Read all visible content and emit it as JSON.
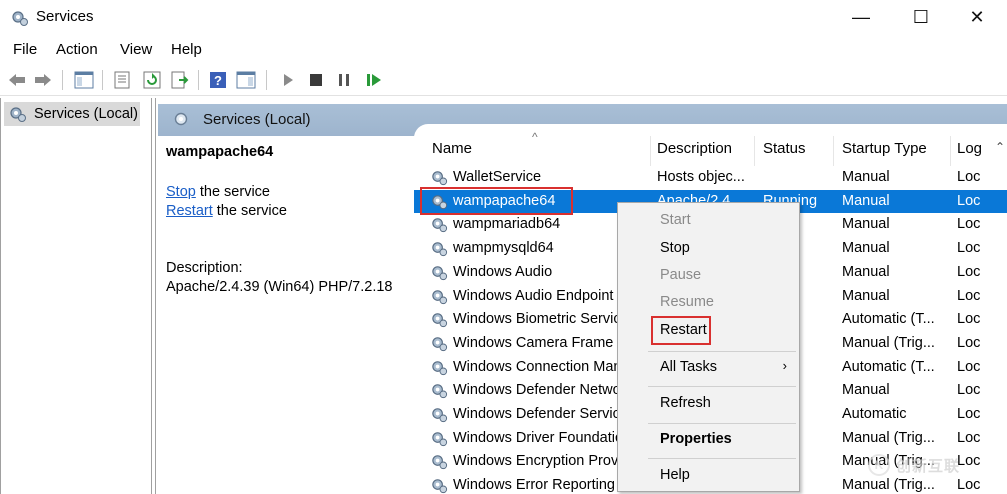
{
  "window": {
    "title": "Services",
    "minimize": "—",
    "maximize": "☐",
    "close": "✕"
  },
  "menu": [
    "File",
    "Action",
    "View",
    "Help"
  ],
  "tree": {
    "item": "Services (Local)"
  },
  "pane": {
    "header": "Services (Local)"
  },
  "left_info": {
    "service_name": "wampapache64",
    "stop_link": "Stop",
    "stop_rest": " the service",
    "restart_link": "Restart",
    "restart_rest": " the service",
    "desc_label": "Description:",
    "desc_text": "Apache/2.4.39 (Win64) PHP/7.2.18"
  },
  "columns": {
    "name": "Name",
    "description": "Description",
    "status": "Status",
    "startup": "Startup Type",
    "logon": "Log"
  },
  "rows": [
    {
      "name": "WalletService",
      "description": "Hosts objec...",
      "status": "",
      "startup": "Manual",
      "logon": "Loc"
    },
    {
      "name": "wampapache64",
      "description": "Apache/2.4...",
      "status": "Running",
      "startup": "Manual",
      "logon": "Loc"
    },
    {
      "name": "wampmariadb64",
      "description": "",
      "status": "ng",
      "startup": "Manual",
      "logon": "Loc"
    },
    {
      "name": "wampmysqld64",
      "description": "",
      "status": "ng",
      "startup": "Manual",
      "logon": "Loc"
    },
    {
      "name": "Windows Audio",
      "description": "",
      "status": "ng",
      "startup": "Manual",
      "logon": "Loc"
    },
    {
      "name": "Windows Audio Endpoint Builder",
      "description": "",
      "status": "",
      "startup": "Manual",
      "logon": "Loc"
    },
    {
      "name": "Windows Biometric Service",
      "description": "",
      "status": "",
      "startup": "Automatic (T...",
      "logon": "Loc"
    },
    {
      "name": "Windows Camera Frame Server",
      "description": "",
      "status": "",
      "startup": "Manual (Trig...",
      "logon": "Loc"
    },
    {
      "name": "Windows Connection Manager",
      "description": "",
      "status": "ng",
      "startup": "Automatic (T...",
      "logon": "Loc"
    },
    {
      "name": "Windows Defender Network Inspection Service",
      "description": "",
      "status": "ng",
      "startup": "Manual",
      "logon": "Loc"
    },
    {
      "name": "Windows Defender Service",
      "description": "",
      "status": "ng",
      "startup": "Automatic",
      "logon": "Loc"
    },
    {
      "name": "Windows Driver Foundation",
      "description": "",
      "status": "ng",
      "startup": "Manual (Trig...",
      "logon": "Loc"
    },
    {
      "name": "Windows Encryption Provider Host Service",
      "description": "",
      "status": "",
      "startup": "Manual (Trig...",
      "logon": "Loc"
    },
    {
      "name": "Windows Error Reporting Service",
      "description": "",
      "status": "",
      "startup": "Manual (Trig...",
      "logon": "Loc"
    }
  ],
  "context_menu": {
    "start": "Start",
    "stop": "Stop",
    "pause": "Pause",
    "resume": "Resume",
    "restart": "Restart",
    "all_tasks": "All Tasks",
    "refresh": "Refresh",
    "properties": "Properties",
    "help": "Help",
    "arrow": "›"
  },
  "watermark": {
    "mark": "K",
    "text": "创新互联"
  },
  "colors": {
    "selection": "#0a78d7",
    "highlight_box": "#d9302f",
    "header": "#a9bfd6"
  }
}
